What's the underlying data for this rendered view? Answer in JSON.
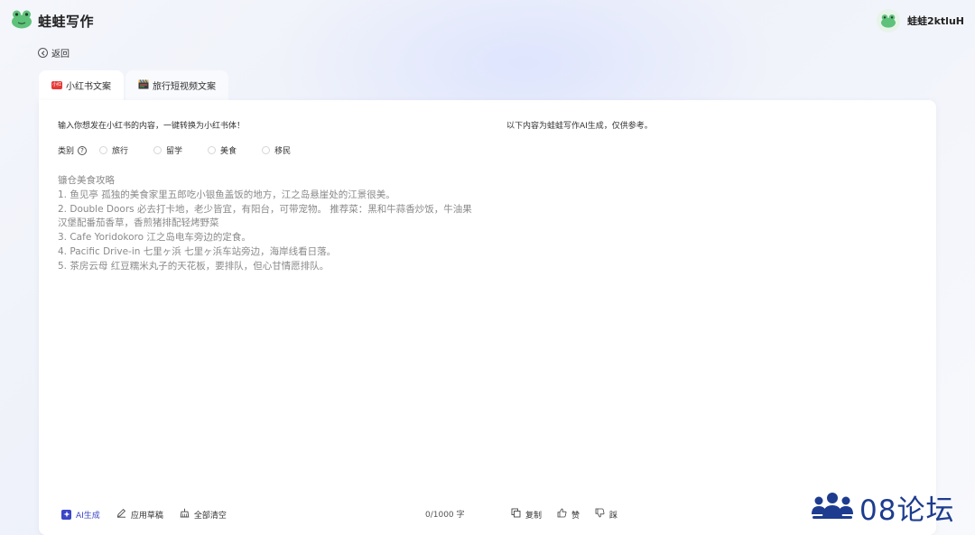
{
  "header": {
    "brand": "蛙蛙写作",
    "username": "蛙蛙2ktluH"
  },
  "back_label": "返回",
  "tabs": [
    {
      "label": "小红书文案",
      "icon": "xiaohongshu-icon",
      "active": true
    },
    {
      "label": "旅行短视频文案",
      "icon": "clapperboard-icon",
      "active": false
    }
  ],
  "form": {
    "prompt": "输入你想发在小红书的内容，一键转换为小红书体！",
    "category_label": "类别",
    "help_glyph": "?",
    "options": [
      "旅行",
      "留学",
      "美食",
      "移民"
    ],
    "content_lines": [
      "镰仓美食攻略",
      "1. 鱼见亭 孤独的美食家里五郎吃小银鱼盖饭的地方，江之岛悬崖处的江景很美。",
      "2. Double Doors 必去打卡地，老少皆宜，有阳台，可带宠物。 推荐菜：黑和牛蒜香炒饭，牛油果",
      "汉堡配番茄香草，香煎猪排配轻烤野菜",
      "3. Cafe Yoridokoro 江之岛电车旁边的定食。",
      "4. Pacific Drive-in 七里ヶ浜 七里ヶ浜车站旁边，海岸线看日落。",
      "5. 茶房云母 红豆糯米丸子的天花板，要排队，但心甘情愿排队。"
    ]
  },
  "result_note": "以下内容为蛙蛙写作AI生成，仅供参考。",
  "actions": {
    "ai_generate": "AI生成",
    "apply_draft": "应用草稿",
    "clear_all": "全部清空",
    "counter": "0/1000 字",
    "copy": "复制",
    "like": "赞",
    "dislike": "踩"
  },
  "watermark": "08论坛",
  "colors": {
    "accent": "#3a45c8",
    "brand_green": "#5ec27a",
    "xiaohongshu_red": "#e53935",
    "watermark_blue": "#1d3c8f"
  }
}
